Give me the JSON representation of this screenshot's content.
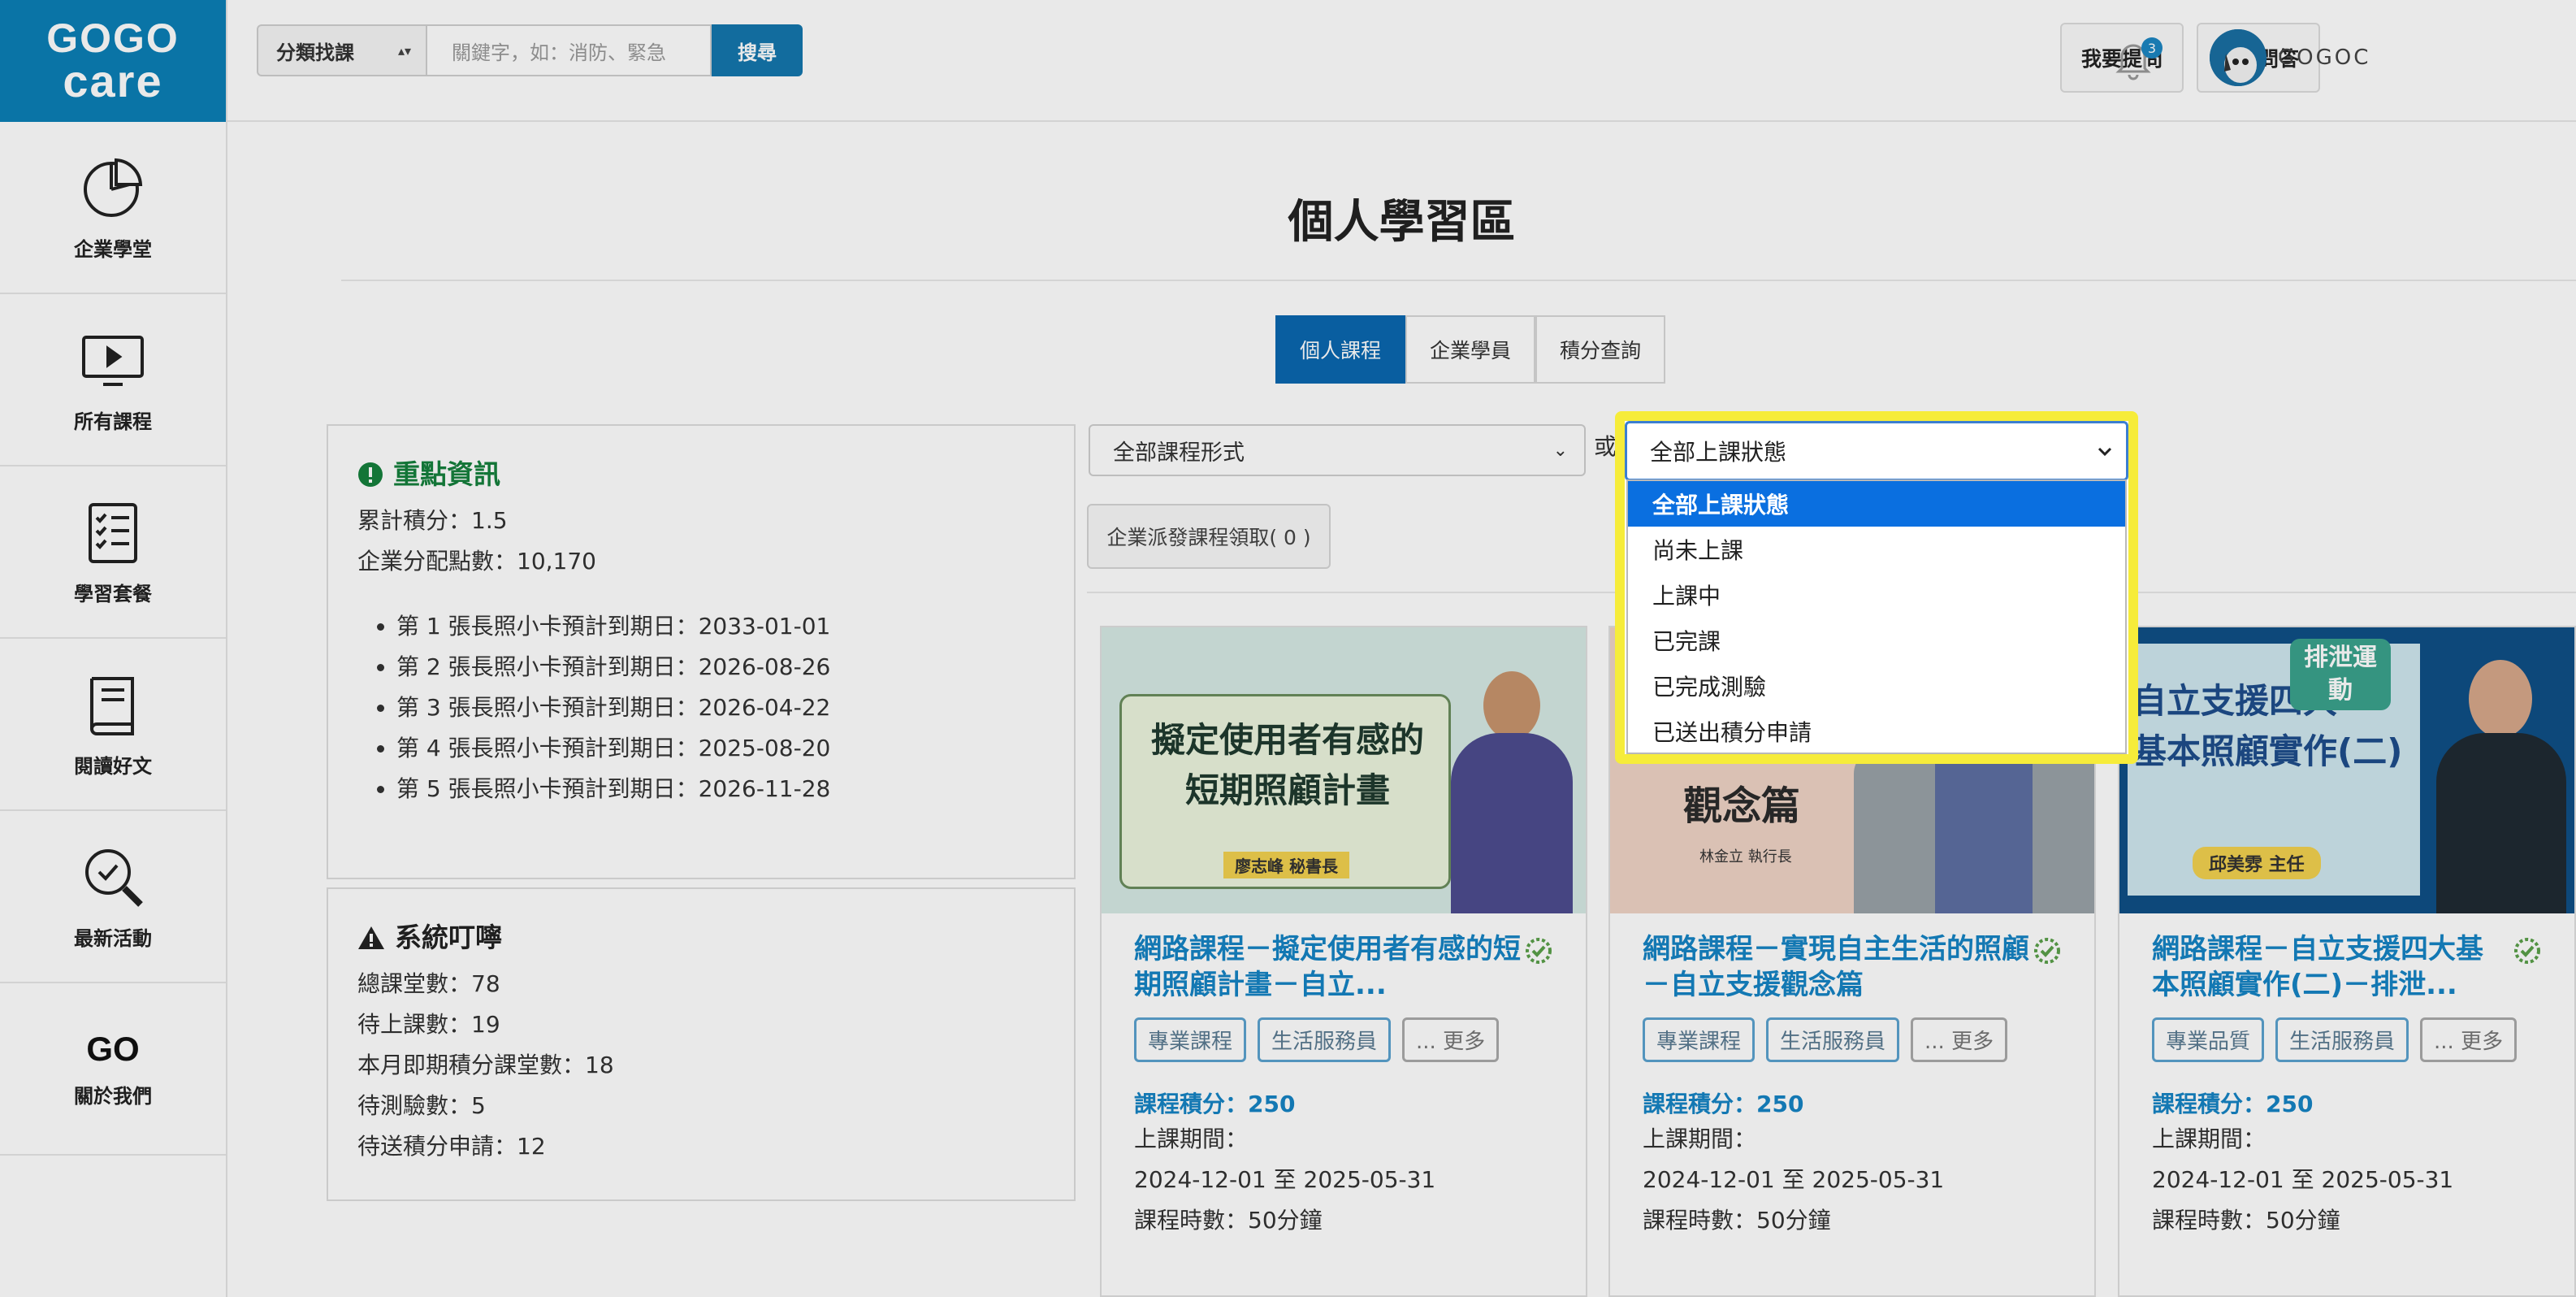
{
  "brand": {
    "logo_line1": "GOGO",
    "logo_line2": "care"
  },
  "sidebar": {
    "items": [
      {
        "label": "企業學堂",
        "icon": "pie-chart-icon"
      },
      {
        "label": "所有課程",
        "icon": "video-screen-icon"
      },
      {
        "label": "學習套餐",
        "icon": "checklist-icon"
      },
      {
        "label": "閱讀好文",
        "icon": "book-icon"
      },
      {
        "label": "最新活動",
        "icon": "search-check-icon"
      },
      {
        "label": "關於我們",
        "icon": "go-logo-icon",
        "logo_text": "GO"
      }
    ]
  },
  "topbar": {
    "category_select": "分類找課",
    "search_placeholder": "關鍵字，如：消防、緊急",
    "search_button": "搜尋",
    "ask_button": "我要提問",
    "faq_button": "常見問答",
    "notification_count": "3",
    "username": "GOGOC"
  },
  "page": {
    "title": "個人學習區",
    "tabs": [
      {
        "label": "個人課程",
        "active": true
      },
      {
        "label": "企業學員",
        "active": false
      },
      {
        "label": "積分查詢",
        "active": false
      }
    ]
  },
  "key_info": {
    "heading": "重點資訊",
    "lines": [
      "累計積分：1.5",
      "企業分配點數：10,170"
    ],
    "cards": [
      "第 1 張長照小卡預計到期日：2033-01-01",
      "第 2 張長照小卡預計到期日：2026-08-26",
      "第 3 張長照小卡預計到期日：2026-04-22",
      "第 4 張長照小卡預計到期日：2025-08-20",
      "第 5 張長照小卡預計到期日：2026-11-28"
    ]
  },
  "reminders": {
    "heading": "系統叮嚀",
    "lines": [
      "總課堂數：78",
      "待上課數：19",
      "本月即期積分課堂數：18",
      "待測驗數：5",
      "待送積分申請：12"
    ]
  },
  "filters": {
    "course_type": "全部課程形式",
    "or_text": "或",
    "status_selected": "全部上課狀態",
    "status_options": [
      "全部上課狀態",
      "尚未上課",
      "上課中",
      "已完課",
      "已完成測驗",
      "已送出積分申請"
    ],
    "assign_button": "企業派發課程領取( 0 )"
  },
  "courses": [
    {
      "title": "網路課程－擬定使用者有感的短期照顧計畫－自立...",
      "thumb_text_1": "擬定使用者有感的",
      "thumb_text_2": "短期照顧計畫",
      "thumb_caption": "廖志峰 秘書長",
      "tags": [
        "專業課程",
        "生活服務員",
        "... 更多"
      ],
      "points": "課程積分：250",
      "period_label": "上課期間：",
      "period": "2024-12-01 至 2025-05-31",
      "duration": "課程時數：50分鐘"
    },
    {
      "title": "網路課程－實現自主生活的照顧－自立支援觀念篇",
      "thumb_text_1": "觀念篇",
      "thumb_text_2": "",
      "thumb_caption": "林金立 執行長",
      "tags": [
        "專業課程",
        "生活服務員",
        "... 更多"
      ],
      "points": "課程積分：250",
      "period_label": "上課期間：",
      "period": "2024-12-01 至 2025-05-31",
      "duration": "課程時數：50分鐘"
    },
    {
      "title": "網路課程－自立支援四大基本照顧實作(二)－排泄...",
      "thumb_text_1": "自立支援四大",
      "thumb_text_2": "基本照顧實作(二)",
      "thumb_badge": "排泄運動",
      "thumb_caption": "邱美雰 主任",
      "tags": [
        "專業品質",
        "生活服務員",
        "... 更多"
      ],
      "points": "課程積分：250",
      "period_label": "上課期間：",
      "period": "2024-12-01 至 2025-05-31",
      "duration": "課程時數：50分鐘"
    }
  ],
  "colors": {
    "brand_blue": "#0b7fb6",
    "link_blue": "#1584c4",
    "highlight_yellow": "#f6ec3a",
    "selected_option": "#0a6fe0"
  }
}
